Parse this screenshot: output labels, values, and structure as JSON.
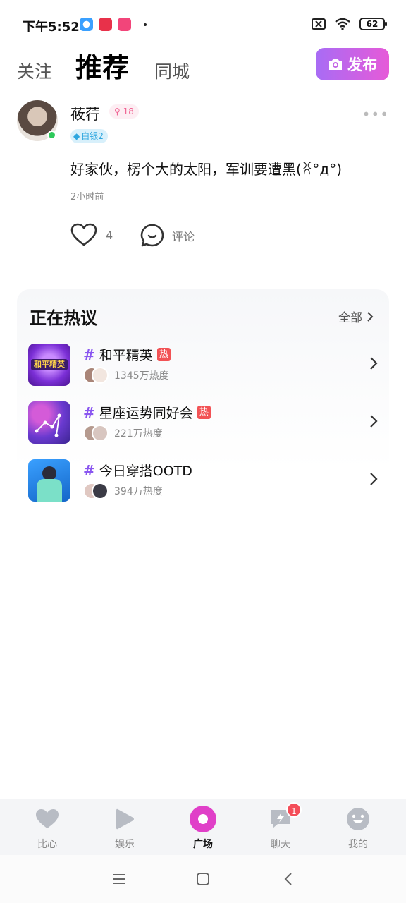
{
  "status_bar": {
    "time": "下午5:52",
    "battery": "62",
    "app_icons": [
      "browser-app-icon",
      "game-app-icon",
      "video-app-icon"
    ]
  },
  "tabs": {
    "follow": "关注",
    "recommend": "推荐",
    "city": "同城",
    "publish": "发布"
  },
  "post": {
    "user_name": "莜荇",
    "age": "18",
    "level": "白银2",
    "text": "好家伙，楞个大的太阳，军训要遭黑(ꐦ°д°)",
    "time": "2小时前",
    "likes": "4",
    "comment_label": "评论"
  },
  "hot": {
    "title": "正在热议",
    "all_label": "全部",
    "items": [
      {
        "name": "和平精英",
        "tag": "热",
        "heat": "1345万热度",
        "thumb_text": "和平精英"
      },
      {
        "name": "星座运势同好会",
        "tag": "热",
        "heat": "221万热度"
      },
      {
        "name": "今日穿搭OOTD",
        "tag": "",
        "heat": "394万热度"
      }
    ]
  },
  "bottom_nav": {
    "items": [
      {
        "label": "比心",
        "icon": "heart-icon"
      },
      {
        "label": "娱乐",
        "icon": "play-icon"
      },
      {
        "label": "广场",
        "icon": "plaza-icon",
        "active": true
      },
      {
        "label": "聊天",
        "icon": "chat-icon",
        "badge": "1"
      },
      {
        "label": "我的",
        "icon": "profile-icon"
      }
    ]
  },
  "colors": {
    "accent_purple": "#8a57f0",
    "publish_gradient_start": "#a86cf5",
    "publish_gradient_end": "#e65ad8",
    "hot_tag": "#f25255",
    "active_nav": "#e040c8"
  }
}
